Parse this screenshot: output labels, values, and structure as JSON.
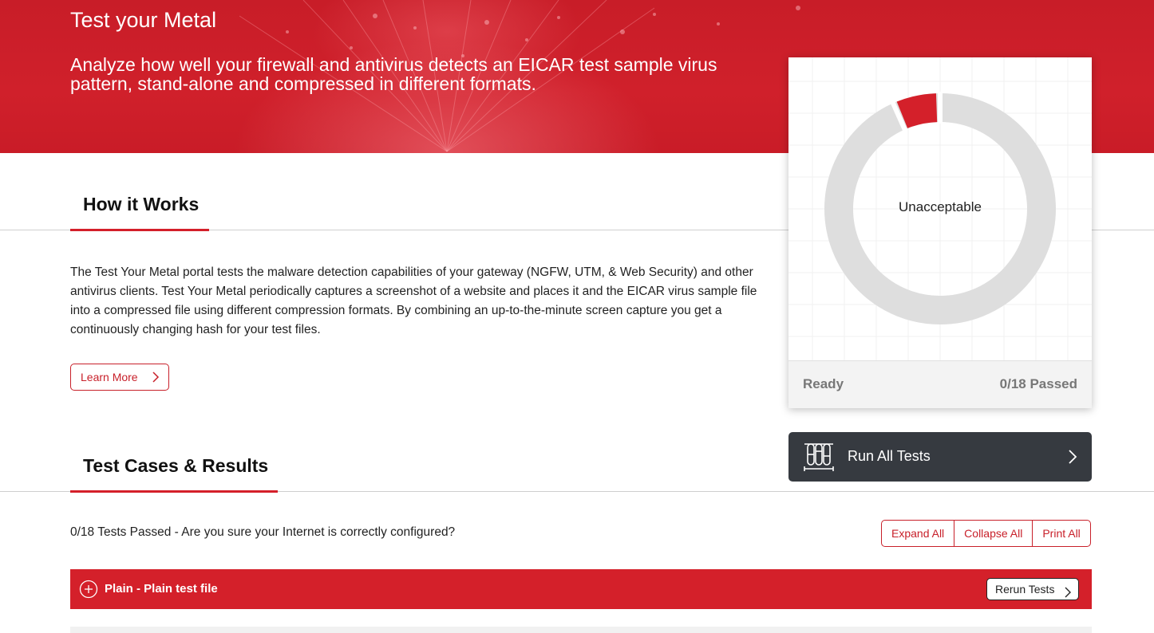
{
  "hero": {
    "title": "Test your Metal",
    "subtitle": "Analyze how well your firewall and antivirus detects an EICAR test sample virus pattern, stand-alone and compressed in different formats."
  },
  "how_it_works": {
    "heading": "How it Works",
    "body": "The Test Your Metal portal tests the malware detection capabilities of your gateway (NGFW, UTM, & Web Security) and other antivirus clients. Test Your Metal periodically captures a screenshot of a website and places it and the EICAR virus sample file into a compressed file using different compression formats. By combining an up-to-the-minute screen capture you get a continuously changing hash for your test files.",
    "learn_more_label": "Learn More"
  },
  "score_card": {
    "rating": "Unacceptable",
    "status": "Ready",
    "passed": "0/18 Passed",
    "passed_count": 0,
    "total_count": 18
  },
  "run_all": {
    "label": "Run All Tests",
    "icon": "test-tubes-icon"
  },
  "test_cases": {
    "heading": "Test Cases & Results",
    "summary": "0/18 Tests Passed - Are you sure your Internet is correctly configured?",
    "expand_all": "Expand All",
    "collapse_all": "Collapse All",
    "print_all": "Print All",
    "groups": [
      {
        "name": "Plain - Plain test file",
        "rerun_label": "Rerun Tests"
      }
    ]
  },
  "colors": {
    "brand_red": "#d4202a",
    "dark_button": "#363a40",
    "donut_track": "#dedede"
  }
}
